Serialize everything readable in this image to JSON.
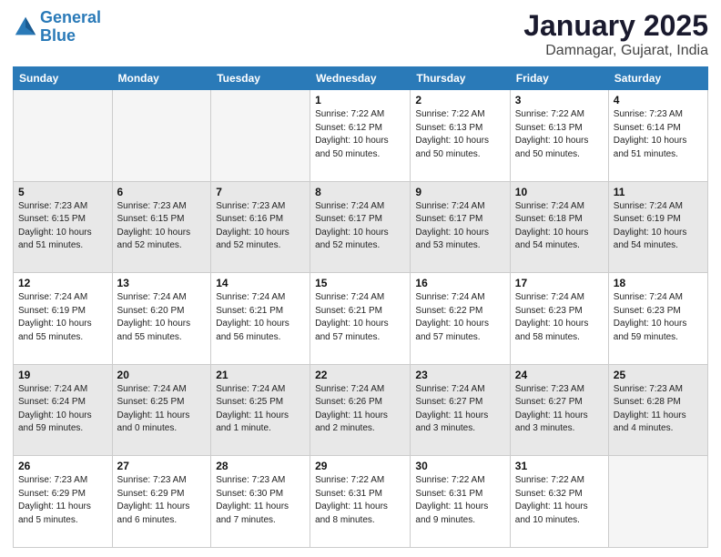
{
  "header": {
    "logo_line1": "General",
    "logo_line2": "Blue",
    "title": "January 2025",
    "subtitle": "Damnagar, Gujarat, India"
  },
  "days_of_week": [
    "Sunday",
    "Monday",
    "Tuesday",
    "Wednesday",
    "Thursday",
    "Friday",
    "Saturday"
  ],
  "weeks": [
    [
      {
        "day": "",
        "info": "",
        "empty": true
      },
      {
        "day": "",
        "info": "",
        "empty": true
      },
      {
        "day": "",
        "info": "",
        "empty": true
      },
      {
        "day": "1",
        "info": "Sunrise: 7:22 AM\nSunset: 6:12 PM\nDaylight: 10 hours\nand 50 minutes."
      },
      {
        "day": "2",
        "info": "Sunrise: 7:22 AM\nSunset: 6:13 PM\nDaylight: 10 hours\nand 50 minutes."
      },
      {
        "day": "3",
        "info": "Sunrise: 7:22 AM\nSunset: 6:13 PM\nDaylight: 10 hours\nand 50 minutes."
      },
      {
        "day": "4",
        "info": "Sunrise: 7:23 AM\nSunset: 6:14 PM\nDaylight: 10 hours\nand 51 minutes."
      }
    ],
    [
      {
        "day": "5",
        "info": "Sunrise: 7:23 AM\nSunset: 6:15 PM\nDaylight: 10 hours\nand 51 minutes.",
        "shaded": true
      },
      {
        "day": "6",
        "info": "Sunrise: 7:23 AM\nSunset: 6:15 PM\nDaylight: 10 hours\nand 52 minutes.",
        "shaded": true
      },
      {
        "day": "7",
        "info": "Sunrise: 7:23 AM\nSunset: 6:16 PM\nDaylight: 10 hours\nand 52 minutes.",
        "shaded": true
      },
      {
        "day": "8",
        "info": "Sunrise: 7:24 AM\nSunset: 6:17 PM\nDaylight: 10 hours\nand 52 minutes.",
        "shaded": true
      },
      {
        "day": "9",
        "info": "Sunrise: 7:24 AM\nSunset: 6:17 PM\nDaylight: 10 hours\nand 53 minutes.",
        "shaded": true
      },
      {
        "day": "10",
        "info": "Sunrise: 7:24 AM\nSunset: 6:18 PM\nDaylight: 10 hours\nand 54 minutes.",
        "shaded": true
      },
      {
        "day": "11",
        "info": "Sunrise: 7:24 AM\nSunset: 6:19 PM\nDaylight: 10 hours\nand 54 minutes.",
        "shaded": true
      }
    ],
    [
      {
        "day": "12",
        "info": "Sunrise: 7:24 AM\nSunset: 6:19 PM\nDaylight: 10 hours\nand 55 minutes."
      },
      {
        "day": "13",
        "info": "Sunrise: 7:24 AM\nSunset: 6:20 PM\nDaylight: 10 hours\nand 55 minutes."
      },
      {
        "day": "14",
        "info": "Sunrise: 7:24 AM\nSunset: 6:21 PM\nDaylight: 10 hours\nand 56 minutes."
      },
      {
        "day": "15",
        "info": "Sunrise: 7:24 AM\nSunset: 6:21 PM\nDaylight: 10 hours\nand 57 minutes."
      },
      {
        "day": "16",
        "info": "Sunrise: 7:24 AM\nSunset: 6:22 PM\nDaylight: 10 hours\nand 57 minutes."
      },
      {
        "day": "17",
        "info": "Sunrise: 7:24 AM\nSunset: 6:23 PM\nDaylight: 10 hours\nand 58 minutes."
      },
      {
        "day": "18",
        "info": "Sunrise: 7:24 AM\nSunset: 6:23 PM\nDaylight: 10 hours\nand 59 minutes."
      }
    ],
    [
      {
        "day": "19",
        "info": "Sunrise: 7:24 AM\nSunset: 6:24 PM\nDaylight: 10 hours\nand 59 minutes.",
        "shaded": true
      },
      {
        "day": "20",
        "info": "Sunrise: 7:24 AM\nSunset: 6:25 PM\nDaylight: 11 hours\nand 0 minutes.",
        "shaded": true
      },
      {
        "day": "21",
        "info": "Sunrise: 7:24 AM\nSunset: 6:25 PM\nDaylight: 11 hours\nand 1 minute.",
        "shaded": true
      },
      {
        "day": "22",
        "info": "Sunrise: 7:24 AM\nSunset: 6:26 PM\nDaylight: 11 hours\nand 2 minutes.",
        "shaded": true
      },
      {
        "day": "23",
        "info": "Sunrise: 7:24 AM\nSunset: 6:27 PM\nDaylight: 11 hours\nand 3 minutes.",
        "shaded": true
      },
      {
        "day": "24",
        "info": "Sunrise: 7:23 AM\nSunset: 6:27 PM\nDaylight: 11 hours\nand 3 minutes.",
        "shaded": true
      },
      {
        "day": "25",
        "info": "Sunrise: 7:23 AM\nSunset: 6:28 PM\nDaylight: 11 hours\nand 4 minutes.",
        "shaded": true
      }
    ],
    [
      {
        "day": "26",
        "info": "Sunrise: 7:23 AM\nSunset: 6:29 PM\nDaylight: 11 hours\nand 5 minutes."
      },
      {
        "day": "27",
        "info": "Sunrise: 7:23 AM\nSunset: 6:29 PM\nDaylight: 11 hours\nand 6 minutes."
      },
      {
        "day": "28",
        "info": "Sunrise: 7:23 AM\nSunset: 6:30 PM\nDaylight: 11 hours\nand 7 minutes."
      },
      {
        "day": "29",
        "info": "Sunrise: 7:22 AM\nSunset: 6:31 PM\nDaylight: 11 hours\nand 8 minutes."
      },
      {
        "day": "30",
        "info": "Sunrise: 7:22 AM\nSunset: 6:31 PM\nDaylight: 11 hours\nand 9 minutes."
      },
      {
        "day": "31",
        "info": "Sunrise: 7:22 AM\nSunset: 6:32 PM\nDaylight: 11 hours\nand 10 minutes."
      },
      {
        "day": "",
        "info": "",
        "empty": true
      }
    ]
  ]
}
